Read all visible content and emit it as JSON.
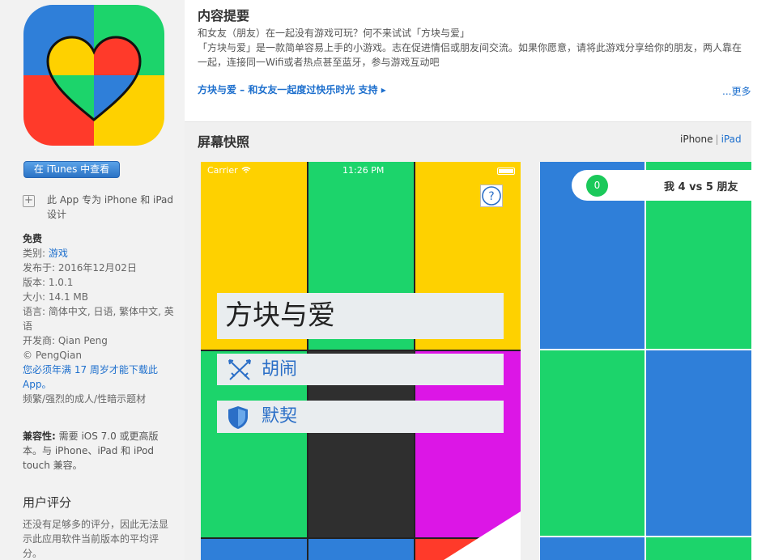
{
  "app": {
    "itunes_button": "在 iTunes 中查看",
    "designed_for": "此 App 专为 iPhone 和 iPad 设计",
    "price": "免费",
    "category_label": "类别:",
    "category_value": "游戏",
    "released": "发布于: 2016年12月02日",
    "version": "版本: 1.0.1",
    "size": "大小:  14.1 MB",
    "languages": "语言: 简体中文, 日语, 繁体中文, 英语",
    "developer": "开发商: Qian Peng",
    "copyright": "© PengQian",
    "age_notice": "您必须年满 17 周岁才能下载此 App。",
    "content_warning": "频繁/强烈的成人/性暗示题材",
    "compat_label": "兼容性:",
    "compat_text": " 需要 iOS 7.0 或更高版本。与 iPhone、iPad 和 iPod touch 兼容。",
    "ratings_title": "用户评分",
    "ratings_text": "还没有足够多的评分，因此无法显示此应用软件当前版本的平均评分。"
  },
  "description": {
    "title": "内容提要",
    "line1": "和女友（朋友）在一起没有游戏可玩？何不来试试「方块与爱」",
    "line2": "「方块与爱」是一款简单容易上手的小游戏。志在促进情侣或朋友间交流。如果你愿意，请将此游戏分享给你的朋友，两人靠在一起，连接同一Wifi或者热点甚至蓝牙，参与游戏互动吧",
    "support_link": "方块与爱 – 和女友一起度过快乐时光 支持 ▸",
    "more": "...更多"
  },
  "screenshots": {
    "title": "屏幕快照",
    "device_iphone": "iPhone",
    "device_separator": "|",
    "device_ipad": "iPad",
    "shot1": {
      "carrier": "Carrier",
      "time": "11:26 PM",
      "game_title": "方块与爱",
      "mode_fight": "胡闹",
      "mode_tacit": "默契"
    },
    "shot2": {
      "score": "0",
      "vs_text": "我 4 vs 5 朋友"
    }
  },
  "colors": {
    "blue": "#2f7fd9",
    "green": "#1cd46b",
    "yellow": "#fed100",
    "red": "#ff3a2a",
    "magenta": "#dc16e6",
    "dark": "#2f2f2f",
    "link": "#1d6fcd"
  }
}
